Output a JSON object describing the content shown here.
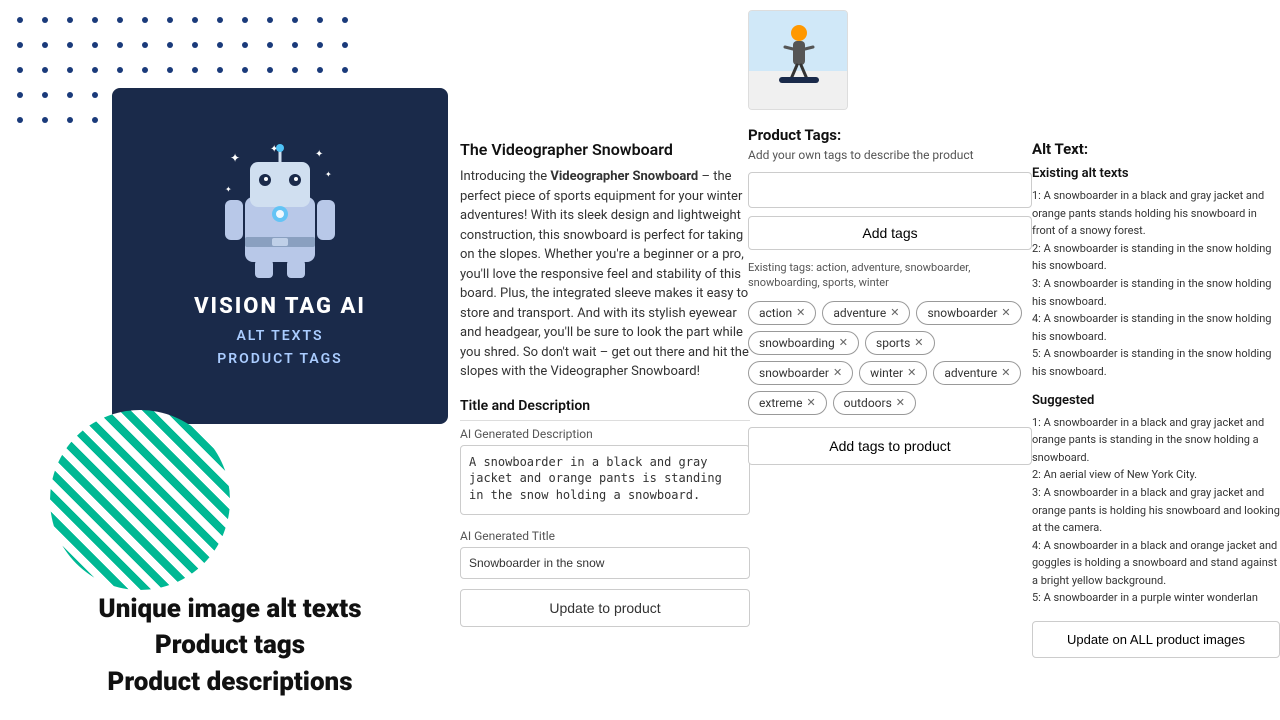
{
  "dots": {
    "color": "#1a3a7a"
  },
  "logo": {
    "title": "VISION TAG AI",
    "subtitle_line1": "ALT TEXTS",
    "subtitle_line2": "PRODUCT TAGS"
  },
  "tagline": {
    "line1": "Unique image alt texts",
    "line2": "Product tags",
    "line3": "Product descriptions"
  },
  "product": {
    "title": "The Videographer Snowboard",
    "description_intro": "Introducing the ",
    "description_bold": "Videographer Snowboard",
    "description_rest": " – the perfect piece of sports equipment for your winter adventures! With its sleek design and lightweight construction, this snowboard is perfect for taking on the slopes. Whether you're a beginner or a pro, you'll love the responsive feel and stability of this board. Plus, the integrated sleeve makes it easy to store and transport. And with its stylish eyewear and headgear, you'll be sure to look the part while you shred. So don't wait – get out there and hit the slopes with the Videographer Snowboard!",
    "section_title": "Title and Description",
    "ai_description_label": "AI Generated Description",
    "ai_description_value": "A snowboarder in a black and gray jacket and orange pants is standing in the snow holding a snowboard.",
    "ai_title_label": "AI Generated Title",
    "ai_title_value": "Snowboarder in the snow",
    "update_btn_label": "Update to product"
  },
  "tags": {
    "panel_title": "Product Tags:",
    "panel_subtitle": "Add your own tags to describe the product",
    "input_placeholder": "",
    "add_btn_label": "Add tags",
    "existing_label": "Existing tags: action, adventure, snowboarder, snowboarding, sports, winter",
    "tags_list": [
      {
        "label": "action",
        "id": "tag-action"
      },
      {
        "label": "adventure",
        "id": "tag-adventure"
      },
      {
        "label": "snowboarder",
        "id": "tag-snowboarder-1"
      },
      {
        "label": "snowboarding",
        "id": "tag-snowboarding"
      },
      {
        "label": "sports",
        "id": "tag-sports"
      },
      {
        "label": "snowboarder",
        "id": "tag-snowboarder-2"
      },
      {
        "label": "winter",
        "id": "tag-winter"
      },
      {
        "label": "adventure",
        "id": "tag-adventure-2"
      },
      {
        "label": "extreme",
        "id": "tag-extreme"
      },
      {
        "label": "outdoors",
        "id": "tag-outdoors"
      }
    ],
    "add_to_product_btn_label": "Add tags to product"
  },
  "alt_text": {
    "section_title": "Alt Text:",
    "existing_title": "Existing alt texts",
    "existing_list": [
      "1: A snowboarder in a black and gray jacket and orange pants stands holding his snowboard in front of a snowy forest.",
      "2: A snowboarder is standing in the snow holding his snowboard.",
      "3: A snowboarder is standing in the snow holding his snowboard.",
      "4: A snowboarder is standing in the snow holding his snowboard.",
      "5: A snowboarder is standing in the snow holding his snowboard."
    ],
    "suggested_title": "Suggested",
    "suggested_list": [
      "1: A snowboarder in a black and gray jacket and orange pants is standing in the snow holding a snowboard.",
      "2: An aerial view of New York City.",
      "3: A snowboarder in a black and gray jacket and orange pants is holding his snowboard and looking at the camera.",
      "4: A snowboarder in a black and orange jacket and goggles is holding a snowboard and stand against a bright yellow background.",
      "5: A snowboarder in a purple winter wonderlan"
    ],
    "update_all_btn_label": "Update on ALL product images"
  }
}
